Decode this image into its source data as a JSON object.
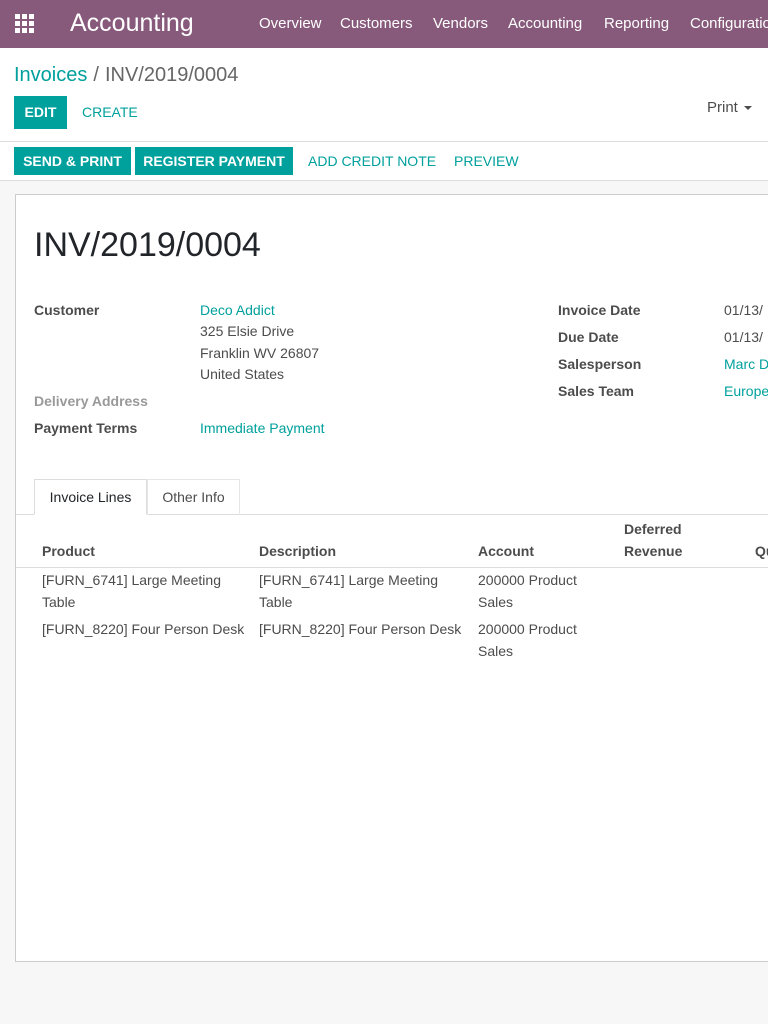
{
  "navbar": {
    "app_name": "Accounting",
    "menu": [
      "Overview",
      "Customers",
      "Vendors",
      "Accounting",
      "Reporting",
      "Configuration"
    ]
  },
  "breadcrumb": {
    "parent": "Invoices",
    "separator": "/",
    "current": "INV/2019/0004"
  },
  "control": {
    "edit": "EDIT",
    "create": "CREATE",
    "print": "Print",
    "send_print": "SEND & PRINT",
    "register_payment": "REGISTER PAYMENT",
    "add_credit_note": "ADD CREDIT NOTE",
    "preview": "PREVIEW"
  },
  "invoice": {
    "number": "INV/2019/0004",
    "customer_label": "Customer",
    "customer_name": "Deco Addict",
    "address_line1": "325 Elsie Drive",
    "address_line2": "Franklin WV 26807",
    "address_line3": "United States",
    "delivery_label": "Delivery Address",
    "payment_terms_label": "Payment Terms",
    "payment_terms": "Immediate Payment",
    "invoice_date_label": "Invoice Date",
    "invoice_date": "01/13/",
    "due_date_label": "Due Date",
    "due_date": "01/13/",
    "salesperson_label": "Salesperson",
    "salesperson": "Marc D",
    "sales_team_label": "Sales Team",
    "sales_team": "Europe"
  },
  "tabs": [
    {
      "label": "Invoice Lines",
      "active": true
    },
    {
      "label": "Other Info",
      "active": false
    }
  ],
  "table": {
    "headers": {
      "product": "Product",
      "description": "Description",
      "account": "Account",
      "deferred_1": "Deferred",
      "deferred_2": "Revenue",
      "quantity": "Qu"
    },
    "rows": [
      {
        "product": "[FURN_6741] Large Meeting Table",
        "description": "[FURN_6741] Large Meeting Table",
        "account": "200000 Product Sales"
      },
      {
        "product": "[FURN_8220] Four Person Desk",
        "description": "[FURN_8220] Four Person Desk",
        "account": "200000 Product Sales"
      }
    ]
  }
}
